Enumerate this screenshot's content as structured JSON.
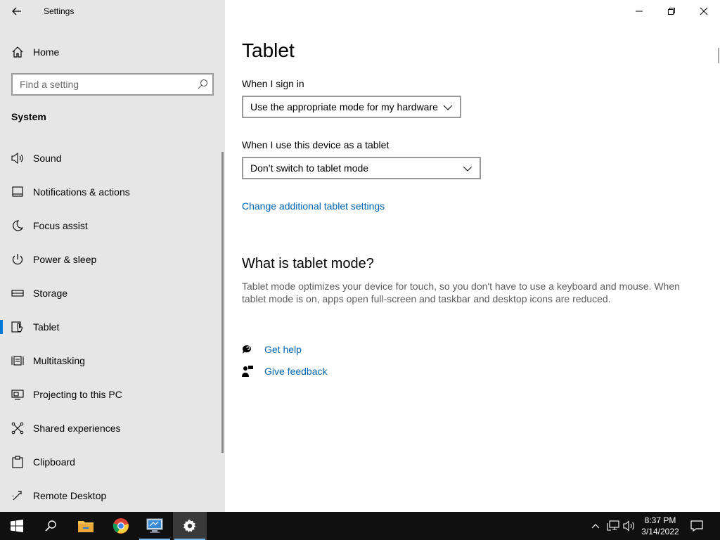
{
  "window": {
    "title": "Settings"
  },
  "sidebar": {
    "home_label": "Home",
    "search_placeholder": "Find a setting",
    "section_title": "System",
    "items": [
      {
        "label": "Sound",
        "icon": "speaker-icon"
      },
      {
        "label": "Notifications & actions",
        "icon": "notification-icon"
      },
      {
        "label": "Focus assist",
        "icon": "moon-icon"
      },
      {
        "label": "Power & sleep",
        "icon": "power-icon"
      },
      {
        "label": "Storage",
        "icon": "storage-icon"
      },
      {
        "label": "Tablet",
        "icon": "tablet-icon",
        "selected": true
      },
      {
        "label": "Multitasking",
        "icon": "multitasking-icon"
      },
      {
        "label": "Projecting to this PC",
        "icon": "projecting-icon"
      },
      {
        "label": "Shared experiences",
        "icon": "shared-icon"
      },
      {
        "label": "Clipboard",
        "icon": "clipboard-icon"
      },
      {
        "label": "Remote Desktop",
        "icon": "remote-desktop-icon"
      }
    ]
  },
  "main": {
    "page_title": "Tablet",
    "sign_in_label": "When I sign in",
    "sign_in_value": "Use the appropriate mode for my hardware",
    "tablet_use_label": "When I use this device as a tablet",
    "tablet_use_value": "Don’t switch to tablet mode",
    "additional_link": "Change additional tablet settings",
    "what_is_heading": "What is tablet mode?",
    "what_is_description": "Tablet mode optimizes your device for touch, so you don't have to use a keyboard and mouse. When tablet mode is on, apps open full-screen and taskbar and desktop icons are reduced.",
    "get_help": "Get help",
    "give_feedback": "Give feedback"
  },
  "taskbar": {
    "time": "8:37 PM",
    "date": "3/14/2022",
    "apps": [
      "start-icon",
      "search-icon",
      "file-explorer-icon",
      "chrome-icon",
      "remote-desktop-app-icon",
      "settings-gear-icon"
    ],
    "active_app": "settings-gear-icon"
  },
  "colors": {
    "accent": "#0078d7",
    "link": "#0063b1",
    "sidebar_bg": "#e6e6e6",
    "taskbar_bg": "#101010"
  }
}
